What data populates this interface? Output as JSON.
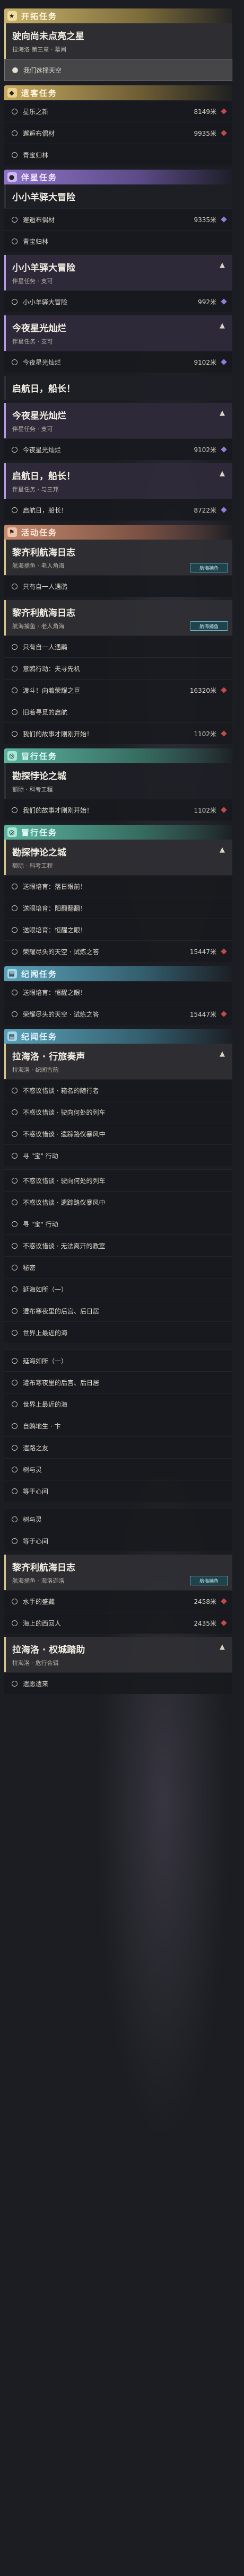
{
  "sections": {
    "trailblaze": {
      "title": "开拓任务",
      "quest_title": "驶向尚未点亮之星",
      "quest_sub": "拉海洛 第三章 · 幕间",
      "step": "我们选择天空"
    },
    "daily": {
      "title": "遗客任务",
      "steps": [
        {
          "label": "星乐之新",
          "dist": "8149米"
        },
        {
          "label": "邂逅布偶材",
          "dist": "9935米"
        },
        {
          "label": "青宝归林",
          "dist": ""
        }
      ]
    },
    "companion": {
      "title": "伴星任务",
      "quests": [
        {
          "title": "小小羊驿大冒险",
          "steps": [
            {
              "label": "邂逅布偶材",
              "dist": "9335米"
            },
            {
              "label": "青宝归林",
              "dist": ""
            }
          ]
        },
        {
          "title": "小小羊驿大冒险",
          "sub": "伴星任务 · 支可",
          "steps": [
            {
              "label": "小小羊驿大冒险",
              "dist": "992米"
            }
          ]
        },
        {
          "title": "今夜星光灿烂",
          "sub": "伴星任务 · 支可",
          "steps": [
            {
              "label": "今夜星光灿烂",
              "dist": "9102米"
            }
          ]
        },
        {
          "title": "启航日，船长！",
          "sub": "",
          "steps": []
        },
        {
          "title": "今夜星光灿烂",
          "sub": "伴星任务 · 支可",
          "steps": [
            {
              "label": "今夜星光灿烂",
              "dist": "9102米"
            }
          ]
        },
        {
          "title": "启航日，船长！",
          "sub": "伴星任务 · 与三邦",
          "steps": [
            {
              "label": "启航日，船长！",
              "dist": "8722米"
            }
          ]
        }
      ]
    },
    "event": {
      "title": "活动任务",
      "badge": "航海捕鱼",
      "quests": [
        {
          "title": "黎齐利航海日志",
          "sub": "航海捕鱼 · 老人角海",
          "steps": [
            {
              "label": "只有自一人遇鹃",
              "dist": ""
            }
          ]
        },
        {
          "title": "黎齐利航海日志",
          "sub": "航海捕鱼 · 老人角海",
          "steps": [
            {
              "label": "只有自一人遇鹃",
              "dist": ""
            },
            {
              "label": "意鸥行动：夫寻先机",
              "dist": ""
            },
            {
              "label": "渡斗！向着荣耀之巨",
              "dist": "16320米"
            },
            {
              "label": "旧着寻觅的启航",
              "dist": ""
            },
            {
              "label": "我们的故事才刚刚开始！",
              "dist": "1102米"
            }
          ]
        }
      ]
    },
    "adventure": {
      "title": "冒行任务",
      "quests": [
        {
          "title": "勘探悖论之城",
          "sub": "额际 · 科考工程",
          "steps": [
            {
              "label": "我们的故事才刚刚开始！",
              "dist": "1102米"
            }
          ]
        }
      ]
    },
    "adventure2": {
      "title": "冒行任务",
      "quests": [
        {
          "title": "勘探悖论之城",
          "sub": "额际 · 科考工程",
          "steps": [
            {
              "label": "送眼培育：落日眼前！",
              "dist": ""
            },
            {
              "label": "送眼培育：阳翻翻翻！",
              "dist": ""
            },
            {
              "label": "送眼培育：恒醒之眼！",
              "dist": ""
            },
            {
              "label": "荣耀尽头的天空 · 试炼之答",
              "dist": "15447米"
            }
          ]
        }
      ]
    },
    "chronicle": {
      "title": "纪闻任务",
      "steps": [
        {
          "label": "送眼培育：恒醒之眼！",
          "dist": ""
        },
        {
          "label": "荣耀尽头的天空 · 试炼之答",
          "dist": "15447米"
        }
      ]
    },
    "chronicle2": {
      "title": "纪闻任务",
      "quests": [
        {
          "title": "拉海洛 · 行旅奏声",
          "sub": "拉海洛 · 纪闻古韵",
          "steps": [
            {
              "label": "不惑议惜谈 · 箱名的随行者",
              "dist": ""
            },
            {
              "label": "不惑议惜谈 · 驶向何处的列车",
              "dist": ""
            },
            {
              "label": "不惑议惜谈 · 遗踪路仪暴风中",
              "dist": ""
            },
            {
              "label": "寻 \"宝\" 行动",
              "dist": ""
            }
          ]
        }
      ]
    },
    "list_a": [
      {
        "label": "不惑议惜谈 · 驶向何处的列车",
        "dist": ""
      },
      {
        "label": "不惑议惜谈 · 遗踪路仪暴风中",
        "dist": ""
      },
      {
        "label": "寻 \"宝\" 行动",
        "dist": ""
      },
      {
        "label": "不惑议惜谈 · 无法离开的教室",
        "dist": ""
      },
      {
        "label": "秘密",
        "dist": ""
      },
      {
        "label": "延海如所（一）",
        "dist": ""
      },
      {
        "label": "遭布寒夜里的后宫、后日居",
        "dist": ""
      },
      {
        "label": "世界上最近的海",
        "dist": ""
      }
    ],
    "list_b": [
      {
        "label": "延海如所（一）",
        "dist": ""
      },
      {
        "label": "遭布寒夜里的后宫、后日居",
        "dist": ""
      },
      {
        "label": "世界上最近的海",
        "dist": ""
      },
      {
        "label": "自鸥地生 · 卞",
        "dist": ""
      },
      {
        "label": "遗路之友",
        "dist": ""
      },
      {
        "label": "树与灵",
        "dist": ""
      },
      {
        "label": "等于心间",
        "dist": ""
      }
    ],
    "list_c": [
      {
        "label": "树与灵",
        "dist": ""
      },
      {
        "label": "等于心间",
        "dist": ""
      }
    ],
    "final_event": {
      "badge": "航海捕鱼",
      "quest_title": "黎齐利航海日志",
      "quest_sub": "航海捕鱼 · 海洛迦洛",
      "steps": [
        {
          "label": "水手的盛藏",
          "dist": "2458米"
        },
        {
          "label": "海上的西回人",
          "dist": "2435米"
        }
      ]
    },
    "final_quest": {
      "title": "拉海洛 · 权城踏助",
      "sub": "拉海洛 · 危行合辑",
      "steps": [
        {
          "label": "遗愿遗来",
          "dist": ""
        }
      ]
    }
  },
  "icons": {
    "trailblaze": "star-icon",
    "daily": "clipboard-icon",
    "companion": "companion-icon",
    "event": "flag-icon",
    "adventure": "compass-icon",
    "chronicle": "scroll-icon"
  }
}
